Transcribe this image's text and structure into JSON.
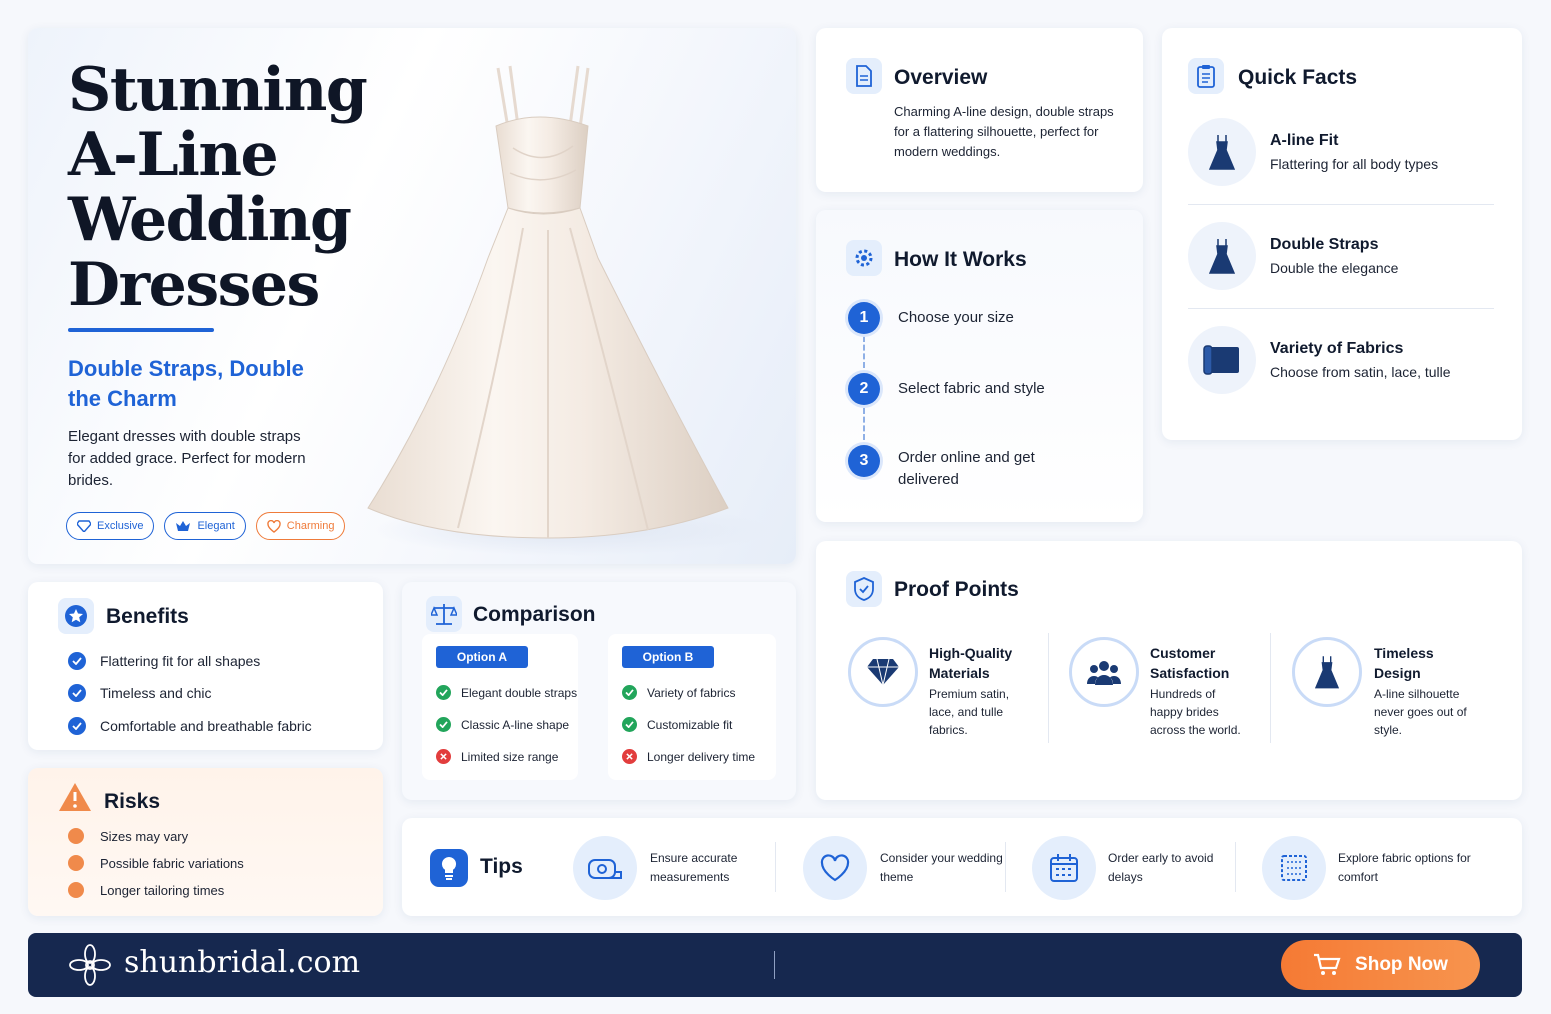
{
  "hero": {
    "title": "Stunning A-Line Wedding Dresses",
    "subtitle": "Double Straps, Double the Charm",
    "description": "Elegant dresses with double straps for added grace. Perfect for modern brides.",
    "badges": [
      {
        "label": "Exclusive",
        "icon": "diamond-icon"
      },
      {
        "label": "Elegant",
        "icon": "crown-icon"
      },
      {
        "label": "Charming",
        "icon": "heart-icon"
      }
    ]
  },
  "overview": {
    "title": "Overview",
    "text": "Charming A-line design, double straps for a flattering silhouette, perfect for modern weddings."
  },
  "how_it_works": {
    "title": "How It Works",
    "steps": [
      {
        "num": "1",
        "text": "Choose your size"
      },
      {
        "num": "2",
        "text": "Select fabric and style"
      },
      {
        "num": "3",
        "text": "Order online and get delivered"
      }
    ]
  },
  "quick_facts": {
    "title": "Quick Facts",
    "items": [
      {
        "title": "A-line Fit",
        "sub": "Flattering for all body types",
        "icon": "dress-icon"
      },
      {
        "title": "Double Straps",
        "sub": "Double the elegance",
        "icon": "dress-icon"
      },
      {
        "title": "Variety of Fabrics",
        "sub": "Choose from satin, lace, tulle",
        "icon": "fabric-roll-icon"
      }
    ]
  },
  "benefits": {
    "title": "Benefits",
    "items": [
      "Flattering fit for all shapes",
      "Timeless and chic",
      "Comfortable and breathable fabric"
    ]
  },
  "risks": {
    "title": "Risks",
    "items": [
      "Sizes may vary",
      "Possible fabric variations",
      "Longer tailoring times"
    ]
  },
  "comparison": {
    "title": "Comparison",
    "options": [
      {
        "label": "Option A",
        "items": [
          {
            "text": "Elegant double straps",
            "good": true
          },
          {
            "text": "Classic A-line shape",
            "good": true
          },
          {
            "text": "Limited size range",
            "good": false
          }
        ]
      },
      {
        "label": "Option B",
        "items": [
          {
            "text": "Variety of fabrics",
            "good": true
          },
          {
            "text": "Customizable fit",
            "good": true
          },
          {
            "text": "Longer delivery time",
            "good": false
          }
        ]
      }
    ]
  },
  "proof": {
    "title": "Proof Points",
    "items": [
      {
        "title": "High-Quality Materials",
        "text": "Premium satin, lace, and tulle fabrics.",
        "icon": "diamond-icon"
      },
      {
        "title": "Customer Satisfaction",
        "text": "Hundreds of happy brides across the world.",
        "icon": "people-icon"
      },
      {
        "title": "Timeless Design",
        "text": "A-line silhouette never goes out of style.",
        "icon": "dress-icon"
      }
    ]
  },
  "tips": {
    "title": "Tips",
    "items": [
      {
        "text": "Ensure accurate measurements",
        "icon": "measuring-tape-icon"
      },
      {
        "text": "Consider your wedding theme",
        "icon": "heart-icon"
      },
      {
        "text": "Order early to avoid delays",
        "icon": "calendar-icon"
      },
      {
        "text": "Explore fabric options for comfort",
        "icon": "fabric-icon"
      }
    ]
  },
  "footer": {
    "brand": "shunbridal.com",
    "shop_label": "Shop Now"
  },
  "colors": {
    "accent": "#1f63d6",
    "navy": "#16284f",
    "orange": "#f57a34"
  }
}
